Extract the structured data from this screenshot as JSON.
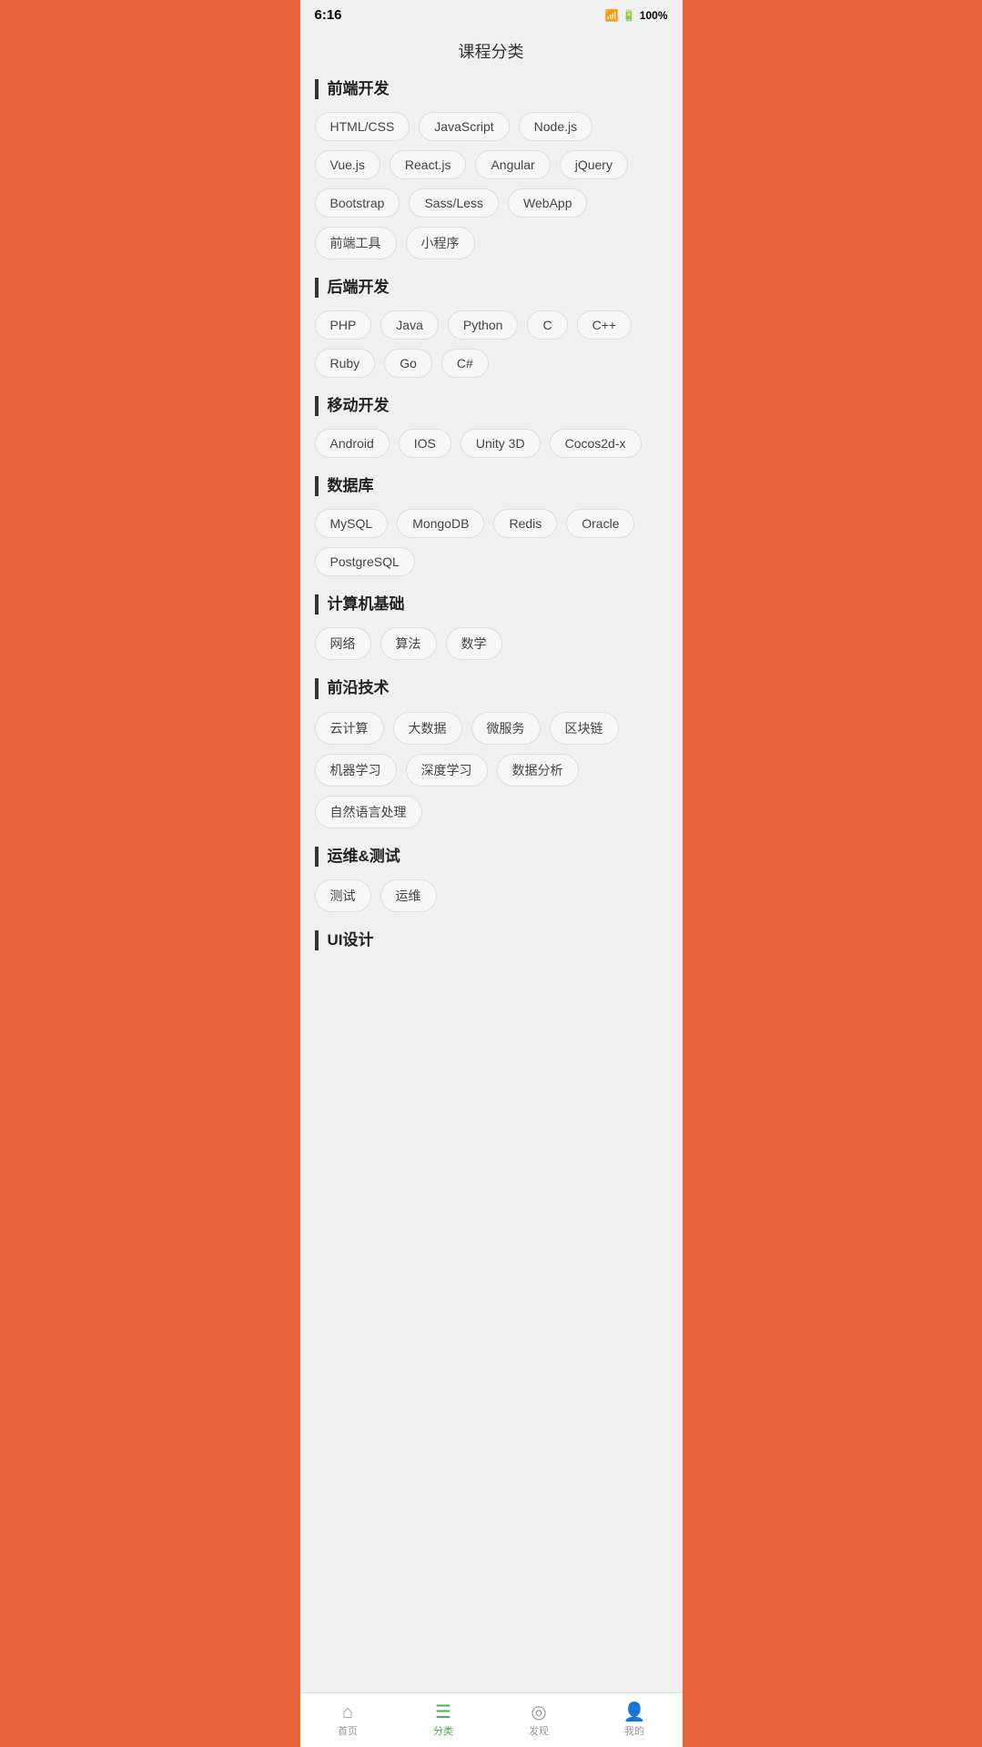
{
  "statusBar": {
    "time": "6:16",
    "battery": "100%"
  },
  "pageTitle": "课程分类",
  "sections": [
    {
      "id": "frontend",
      "title": "前端开发",
      "tags": [
        "HTML/CSS",
        "JavaScript",
        "Node.js",
        "Vue.js",
        "React.js",
        "Angular",
        "jQuery",
        "Bootstrap",
        "Sass/Less",
        "WebApp",
        "前端工具",
        "小程序"
      ]
    },
    {
      "id": "backend",
      "title": "后端开发",
      "tags": [
        "PHP",
        "Java",
        "Python",
        "C",
        "C++",
        "Ruby",
        "Go",
        "C#"
      ]
    },
    {
      "id": "mobile",
      "title": "移动开发",
      "tags": [
        "Android",
        "IOS",
        "Unity 3D",
        "Cocos2d-x"
      ]
    },
    {
      "id": "database",
      "title": "数据库",
      "tags": [
        "MySQL",
        "MongoDB",
        "Redis",
        "Oracle",
        "PostgreSQL"
      ]
    },
    {
      "id": "cs-basics",
      "title": "计算机基础",
      "tags": [
        "网络",
        "算法",
        "数学"
      ]
    },
    {
      "id": "frontier",
      "title": "前沿技术",
      "tags": [
        "云计算",
        "大数据",
        "微服务",
        "区块链",
        "机器学习",
        "深度学习",
        "数据分析",
        "自然语言处理"
      ]
    },
    {
      "id": "devops",
      "title": "运维&测试",
      "tags": [
        "测试",
        "运维"
      ]
    },
    {
      "id": "ui-design",
      "title": "UI设计",
      "tags": []
    }
  ],
  "bottomNav": [
    {
      "id": "home",
      "label": "首页",
      "icon": "⌂",
      "active": false
    },
    {
      "id": "category",
      "label": "分类",
      "icon": "☰",
      "active": true
    },
    {
      "id": "discover",
      "label": "发现",
      "icon": "◎",
      "active": false
    },
    {
      "id": "mine",
      "label": "我的",
      "icon": "👤",
      "active": false
    }
  ]
}
